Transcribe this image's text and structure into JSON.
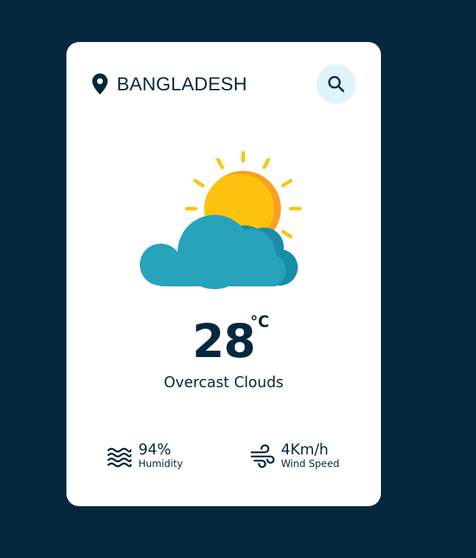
{
  "location": {
    "name": "BANGLADESH",
    "icon": "map-pin-icon"
  },
  "search": {
    "icon": "search-icon"
  },
  "weather": {
    "icon": "sun-behind-cloud-icon",
    "temperature": "28",
    "unit": "°C",
    "description": "Overcast Clouds"
  },
  "details": {
    "humidity": {
      "value": "94%",
      "label": "Humidity",
      "icon": "waves-icon"
    },
    "wind": {
      "value": "4Km/h",
      "label": "Wind Speed",
      "icon": "wind-icon"
    }
  },
  "colors": {
    "background": "#06283d",
    "card": "#ffffff",
    "text": "#06283d",
    "search_bg": "#dff4fc",
    "sun": "#fbc20f",
    "sun_shade": "#f6a21e",
    "cloud": "#27a3bb",
    "cloud_shade": "#1a8ca6"
  }
}
